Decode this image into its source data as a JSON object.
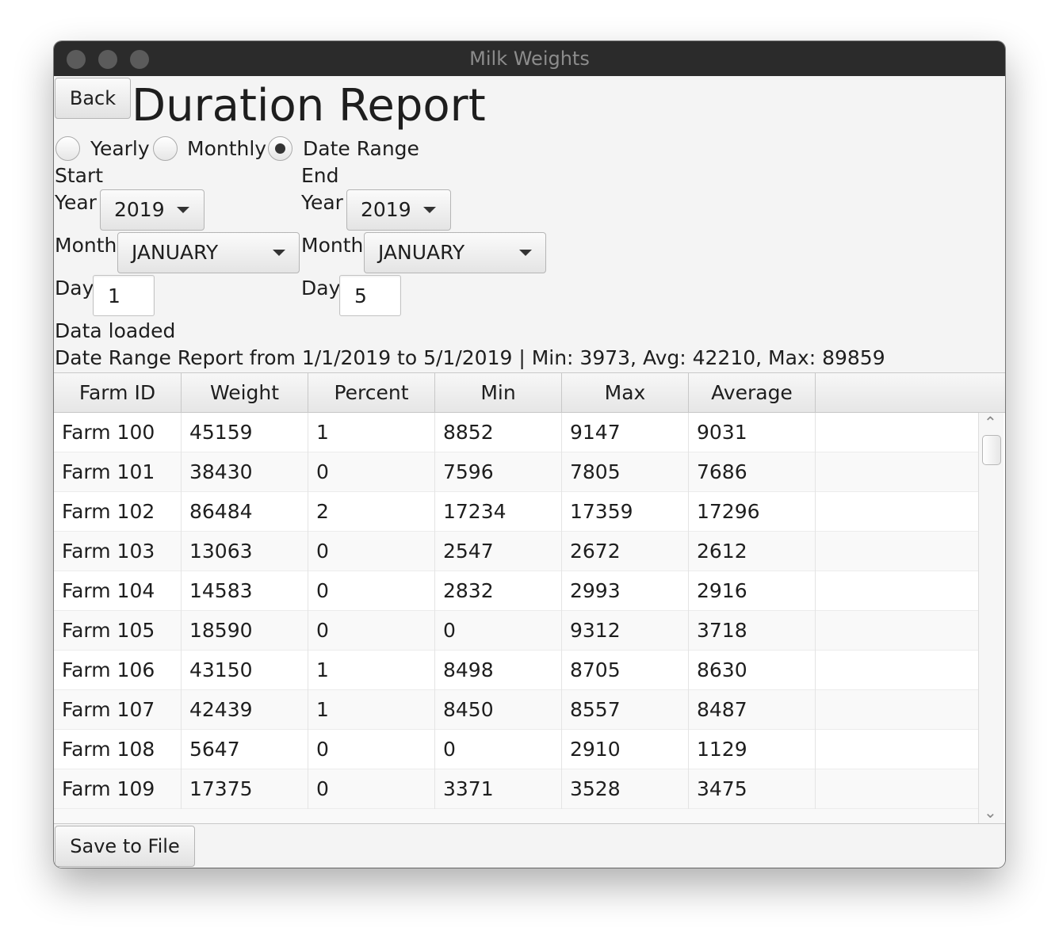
{
  "window": {
    "title": "Milk Weights"
  },
  "header": {
    "back_label": "Back",
    "title": "Duration Report"
  },
  "modes": [
    {
      "label": "Yearly",
      "selected": false
    },
    {
      "label": "Monthly",
      "selected": false
    },
    {
      "label": "Date Range",
      "selected": true
    }
  ],
  "start": {
    "title": "Start",
    "year_label": "Year",
    "year": "2019",
    "month_label": "Month",
    "month": "JANUARY",
    "day_label": "Day",
    "day": "1"
  },
  "end": {
    "title": "End",
    "year_label": "Year",
    "year": "2019",
    "month_label": "Month",
    "month": "JANUARY",
    "day_label": "Day",
    "day": "5"
  },
  "status": {
    "loaded": "Data loaded",
    "summary": "Date Range Report from 1/1/2019 to 5/1/2019 | Min: 3973, Avg: 42210, Max: 89859"
  },
  "table": {
    "columns": [
      "Farm ID",
      "Weight",
      "Percent",
      "Min",
      "Max",
      "Average"
    ],
    "rows": [
      [
        "Farm 100",
        "45159",
        "1",
        "8852",
        "9147",
        "9031"
      ],
      [
        "Farm 101",
        "38430",
        "0",
        "7596",
        "7805",
        "7686"
      ],
      [
        "Farm 102",
        "86484",
        "2",
        "17234",
        "17359",
        "17296"
      ],
      [
        "Farm 103",
        "13063",
        "0",
        "2547",
        "2672",
        "2612"
      ],
      [
        "Farm 104",
        "14583",
        "0",
        "2832",
        "2993",
        "2916"
      ],
      [
        "Farm 105",
        "18590",
        "0",
        "0",
        "9312",
        "3718"
      ],
      [
        "Farm 106",
        "43150",
        "1",
        "8498",
        "8705",
        "8630"
      ],
      [
        "Farm 107",
        "42439",
        "1",
        "8450",
        "8557",
        "8487"
      ],
      [
        "Farm 108",
        "5647",
        "0",
        "0",
        "2910",
        "1129"
      ],
      [
        "Farm 109",
        "17375",
        "0",
        "3371",
        "3528",
        "3475"
      ]
    ]
  },
  "footer": {
    "save_label": "Save to File"
  }
}
